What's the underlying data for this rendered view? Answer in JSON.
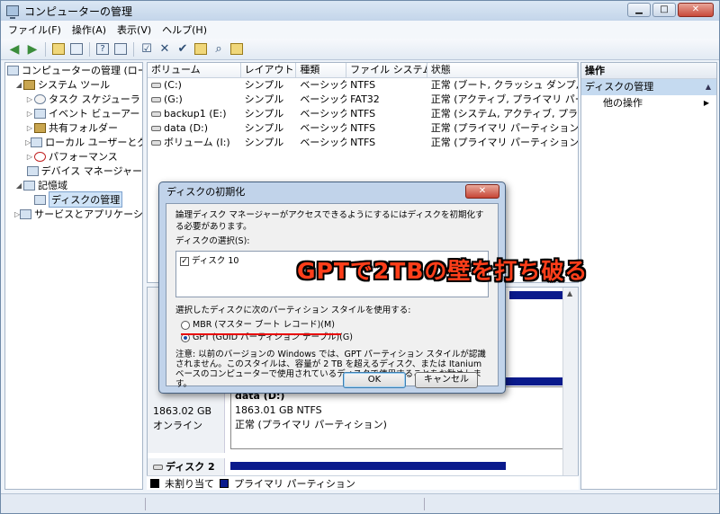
{
  "window": {
    "title": "コンピューターの管理"
  },
  "menu": [
    "ファイル(F)",
    "操作(A)",
    "表示(V)",
    "ヘルプ(H)"
  ],
  "tree": [
    {
      "label": "コンピューターの管理 (ロー",
      "indent": 0,
      "exp": ""
    },
    {
      "label": "システム ツール",
      "indent": 1,
      "exp": "◢"
    },
    {
      "label": "タスク スケジューラ",
      "indent": 2,
      "exp": "▷"
    },
    {
      "label": "イベント ビューアー",
      "indent": 2,
      "exp": "▷"
    },
    {
      "label": "共有フォルダー",
      "indent": 2,
      "exp": "▷"
    },
    {
      "label": "ローカル ユーザーとグ",
      "indent": 2,
      "exp": "▷"
    },
    {
      "label": "パフォーマンス",
      "indent": 2,
      "exp": "▷"
    },
    {
      "label": "デバイス マネージャー",
      "indent": 2,
      "exp": ""
    },
    {
      "label": "記憶域",
      "indent": 1,
      "exp": "◢"
    },
    {
      "label": "ディスクの管理",
      "indent": 2,
      "exp": ""
    },
    {
      "label": "サービスとアプリケーショ",
      "indent": 1,
      "exp": "▷"
    }
  ],
  "table": {
    "headers": [
      "ボリューム",
      "レイアウト",
      "種類",
      "ファイル システム",
      "状態"
    ],
    "rows": [
      [
        "(C:)",
        "シンプル",
        "ベーシック",
        "NTFS",
        "正常 (ブート, クラッシュ ダンプ, プラ"
      ],
      [
        "(G:)",
        "シンプル",
        "ベーシック",
        "FAT32",
        "正常 (アクティブ, プライマリ パーティ"
      ],
      [
        "backup1 (E:)",
        "シンプル",
        "ベーシック",
        "NTFS",
        "正常 (システム, アクティブ, プライマ"
      ],
      [
        "data (D:)",
        "シンプル",
        "ベーシック",
        "NTFS",
        "正常 (プライマリ パーティション)"
      ],
      [
        "ボリューム (I:)",
        "シンプル",
        "ベーシック",
        "NTFS",
        "正常 (プライマリ パーティション)"
      ]
    ]
  },
  "actions": {
    "header": "操作",
    "section": "ディスクの管理",
    "item": "他の操作"
  },
  "disk_panel": {
    "size": "1863.02 GB",
    "status": "オンライン",
    "partition_name": "data (D:)",
    "partition_size": "1863.01 GB NTFS",
    "partition_status": "正常 (プライマリ パーティション)",
    "disk2_label": "ディスク 2",
    "legend_unalloc": "未割り当て",
    "legend_primary": "プライマリ パーティション"
  },
  "dialog": {
    "title": "ディスクの初期化",
    "intro": "論理ディスク マネージャーがアクセスできるようにするにはディスクを初期化する必要があります。",
    "select_label": "ディスクの選択(S):",
    "disk_item": "ディスク 10",
    "style_label": "選択したディスクに次のパーティション スタイルを使用する:",
    "mbr": "MBR (マスター ブート レコード)(M)",
    "gpt": "GPT (GUID パーティション テーブル)(G)",
    "note": "注意: 以前のバージョンの Windows では、GPT パーティション スタイルが認識されません。このスタイルは、容量が 2 TB を超えるディスク、または Itanium ベースのコンピューターで使用されているディスクで使用することをお勧めします。",
    "ok": "OK",
    "cancel": "キャンセル",
    "close": "✕"
  },
  "overlay": "GPTで2TBの壁を打ち破る",
  "colors": {
    "primary_partition": "#0a1a8c",
    "unallocated": "#000000",
    "overlay": "#ff3e1a"
  }
}
